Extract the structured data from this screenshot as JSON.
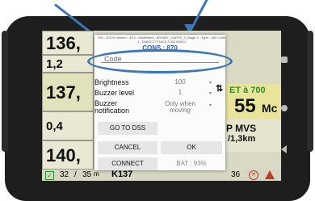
{
  "dialog": {
    "info_text": "S/N : 22120 Version : 3/74 - ModbWerk : 600/600 _CARTE_3_Stage 3 - Type : 1B4 Code 1 - D0002 CT RACK 3 VIA B39XJ",
    "connection_title": "CONS : 870",
    "code_placeholder": "Code",
    "settings": [
      {
        "label": "Brightness",
        "value": "100"
      },
      {
        "label": "Buzzer level",
        "value": "1"
      },
      {
        "label": "Buzzer notification",
        "value": "Only when moving"
      }
    ],
    "go_to_dss_label": "GO TO DSS",
    "cancel_label": "CANCEL",
    "ok_label": "OK",
    "connect_label": "CONNECT",
    "battery_text": "BAT : 93%"
  },
  "dashboard": {
    "left_values": [
      "136,",
      "1,2",
      "137,",
      "0,4",
      "140,"
    ],
    "right_texts": {
      "et": "ET à 700",
      "big": "55",
      "unit": "Mc",
      "mvs": "P MVS",
      "dist": "/1,3km"
    },
    "status": {
      "count_left": "32",
      "count_sep": "/",
      "count_right": "35",
      "unit_m": "m",
      "kilometer": "K137",
      "right_number": "36"
    }
  },
  "colors": {
    "annotation_blue": "#3a76b8",
    "status_green": "#2f8f2f",
    "status_red": "#c0392b",
    "right_highlight": "#e8e49a"
  }
}
